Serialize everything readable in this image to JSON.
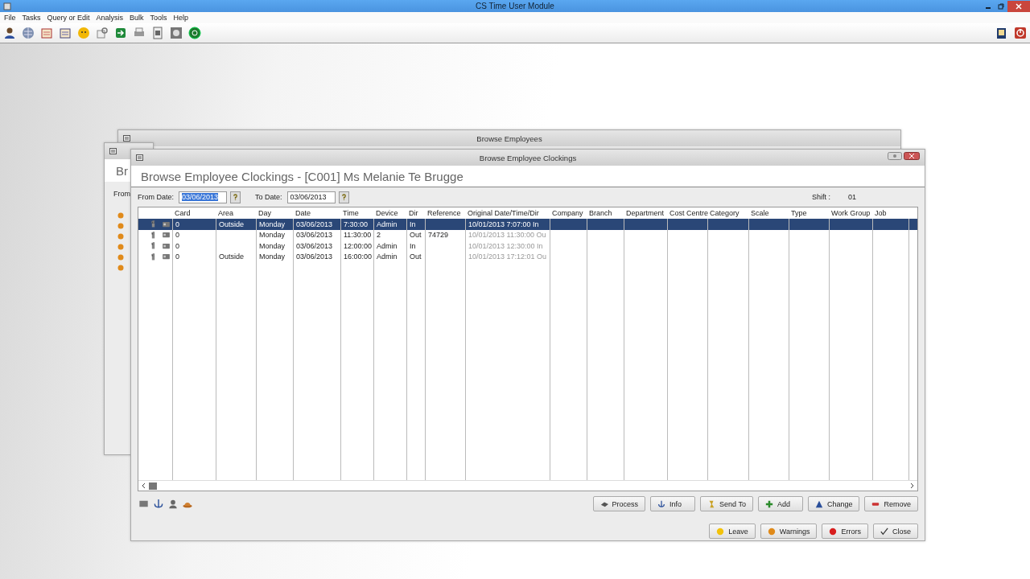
{
  "app": {
    "title": "CS Time User Module",
    "menu": [
      "File",
      "Tasks",
      "Query or Edit",
      "Analysis",
      "Bulk",
      "Tools",
      "Help"
    ]
  },
  "back_windows": [
    {
      "title": "Browse Employees"
    },
    {
      "heading": "Br",
      "from_label": "From"
    }
  ],
  "clockings_window": {
    "title": "Browse Employee Clockings",
    "heading": "Browse Employee Clockings - [C001] Ms Melanie Te Brugge",
    "from_date": {
      "label": "From Date:",
      "value": "03/06/2013",
      "text_selected": true
    },
    "to_date": {
      "label": "To Date:",
      "value": "03/06/2013",
      "text_selected": false
    },
    "shift": {
      "label": "Shift :",
      "value": "01"
    },
    "table": {
      "columns": [
        "Card",
        "Area",
        "Day",
        "Date",
        "Time",
        "Device",
        "Dir",
        "Reference",
        "Original Date/Time/Dir",
        "Company",
        "Branch",
        "Department",
        "Cost Centre",
        "Category",
        "Scale",
        "Type",
        "Work Group",
        "Job"
      ],
      "rows": [
        {
          "selected": true,
          "card": "0",
          "area": "Outside",
          "day": "Monday",
          "date": "03/06/2013",
          "time": "7:30:00",
          "device": "Admin",
          "dir": "In",
          "original": "10/01/2013  7:07:00 In"
        },
        {
          "selected": false,
          "card": "0",
          "day": "Monday",
          "date": "03/06/2013",
          "time": "11:30:00",
          "device": "2",
          "dir": "Out",
          "reference": "74729",
          "original": "10/01/2013 11:30:00 Ou"
        },
        {
          "selected": false,
          "card": "0",
          "day": "Monday",
          "date": "03/06/2013",
          "time": "12:00:00",
          "device": "Admin",
          "dir": "In",
          "original": "10/01/2013 12:30:00 In"
        },
        {
          "selected": false,
          "card": "0",
          "area": "Outside",
          "day": "Monday",
          "date": "03/06/2013",
          "time": "16:00:00",
          "device": "Admin",
          "dir": "Out",
          "original": "10/01/2013 17:12:01 Ou"
        }
      ]
    },
    "buttons_top": [
      {
        "label": "Process",
        "kind": "process"
      },
      {
        "label": "Info",
        "kind": "info"
      },
      {
        "label": "Send To",
        "kind": "send"
      },
      {
        "label": "Add",
        "kind": "add"
      },
      {
        "label": "Change",
        "kind": "change"
      },
      {
        "label": "Remove",
        "kind": "remove"
      }
    ],
    "buttons_bottom": [
      {
        "label": "Leave",
        "kind": "leave"
      },
      {
        "label": "Warnings",
        "kind": "warnings"
      },
      {
        "label": "Errors",
        "kind": "errors"
      },
      {
        "label": "Close",
        "kind": "close"
      }
    ]
  }
}
